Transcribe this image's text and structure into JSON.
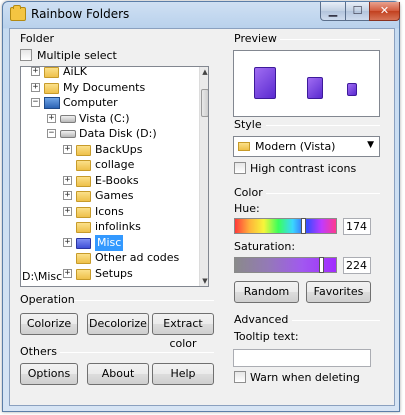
{
  "window": {
    "title": "Rainbow Folders"
  },
  "folder_group": {
    "label": "Folder",
    "multiple_select": "Multiple select",
    "tree": [
      {
        "label": "AiLK",
        "indent": 0,
        "expander": "+",
        "icon": "folder"
      },
      {
        "label": "My Documents",
        "indent": 0,
        "expander": "+",
        "icon": "folder"
      },
      {
        "label": "Computer",
        "indent": 0,
        "expander": "-",
        "icon": "computer"
      },
      {
        "label": "Vista (C:)",
        "indent": 1,
        "expander": "+",
        "icon": "drive"
      },
      {
        "label": "Data Disk (D:)",
        "indent": 1,
        "expander": "-",
        "icon": "drive"
      },
      {
        "label": "BackUps",
        "indent": 2,
        "expander": "+",
        "icon": "folder"
      },
      {
        "label": "collage",
        "indent": 2,
        "expander": "",
        "icon": "folder"
      },
      {
        "label": "E-Books",
        "indent": 2,
        "expander": "+",
        "icon": "folder"
      },
      {
        "label": "Games",
        "indent": 2,
        "expander": "+",
        "icon": "folder"
      },
      {
        "label": "Icons",
        "indent": 2,
        "expander": "+",
        "icon": "folder"
      },
      {
        "label": "infolinks",
        "indent": 2,
        "expander": "",
        "icon": "folder"
      },
      {
        "label": "Misc",
        "indent": 2,
        "expander": "+",
        "icon": "folder-blue",
        "selected": true
      },
      {
        "label": "Other ad codes",
        "indent": 2,
        "expander": "",
        "icon": "folder"
      },
      {
        "label": "Setups",
        "indent": 2,
        "expander": "+",
        "icon": "folder"
      }
    ],
    "path": "D:\\Misc"
  },
  "operation": {
    "label": "Operation",
    "colorize": "Colorize",
    "decolorize": "Decolorize",
    "extract_color": "Extract color"
  },
  "others": {
    "label": "Others",
    "options": "Options",
    "about": "About",
    "help": "Help"
  },
  "preview": {
    "label": "Preview"
  },
  "style": {
    "label": "Style",
    "selected": "Modern (Vista)",
    "high_contrast": "High contrast icons"
  },
  "color": {
    "label": "Color",
    "hue_label": "Hue:",
    "hue_value": "174",
    "saturation_label": "Saturation:",
    "saturation_value": "224",
    "random": "Random",
    "favorites": "Favorites"
  },
  "advanced": {
    "label": "Advanced",
    "tooltip_label": "Tooltip text:",
    "tooltip_value": "",
    "warn": "Warn when deleting"
  },
  "colors": {
    "selection": "#3399ff",
    "preview_folder": "#7a3ff0"
  }
}
